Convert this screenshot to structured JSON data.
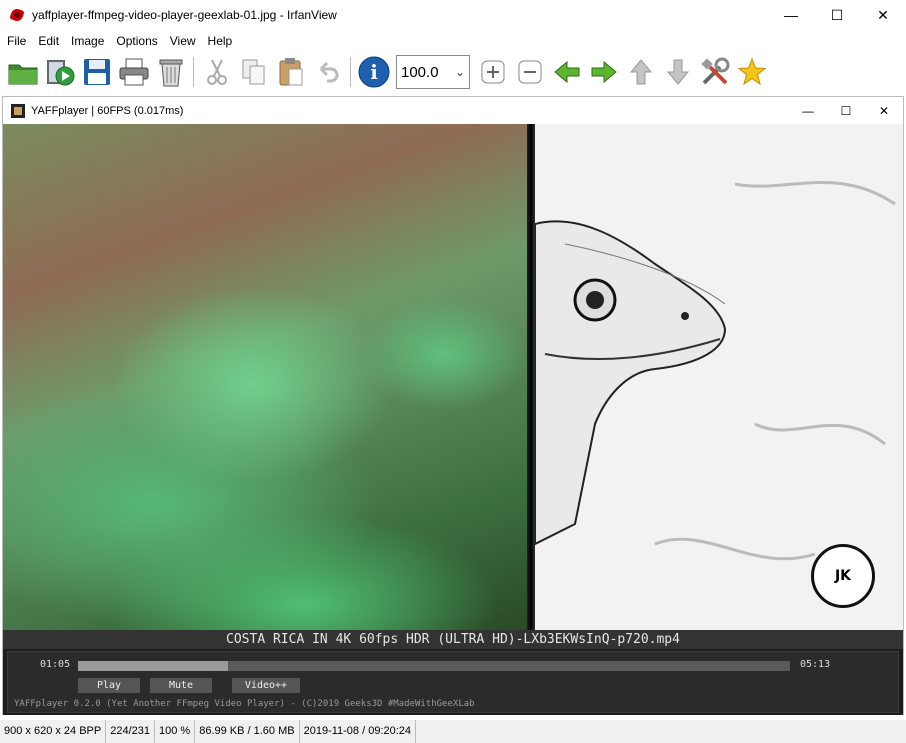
{
  "window": {
    "title": "yaffplayer-ffmpeg-video-player-geexlab-01.jpg - IrfanView",
    "minimize": "—",
    "maximize": "☐",
    "close": "✕"
  },
  "menu": [
    "File",
    "Edit",
    "Image",
    "Options",
    "View",
    "Help"
  ],
  "toolbar": {
    "zoom_value": "100.0",
    "zoom_arrow": "⌄",
    "info_glyph": "i"
  },
  "player_window": {
    "title": "YAFFplayer | 60FPS (0.017ms)",
    "minimize": "—",
    "maximize": "☐",
    "close": "✕"
  },
  "player": {
    "filename": "COSTA RICA IN 4K 60fps HDR (ULTRA HD)-LXb3EKWsInQ-p720.mp4",
    "current_time": "01:05",
    "total_time": "05:13",
    "progress": 0.21,
    "buttons": [
      "Play",
      "Mute",
      "Video++"
    ],
    "footer": "YAFFplayer 0.2.0 (Yet Another FFmpeg Video Player) - (C)2019 Geeks3D #MadeWithGeeXLab",
    "logo_text": "JK"
  },
  "status": [
    "900 x 620 x 24 BPP",
    "224/231",
    "100 %",
    "86.99 KB / 1.60 MB",
    "2019-11-08 / 09:20:24"
  ]
}
